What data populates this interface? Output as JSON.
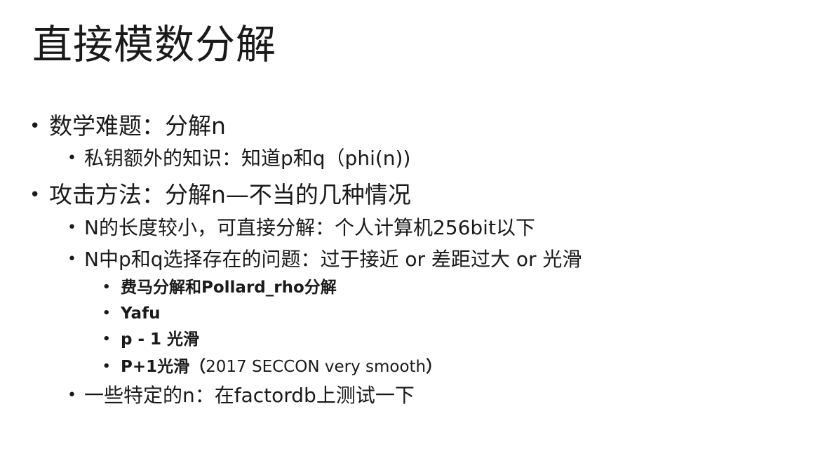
{
  "slide": {
    "title": "直接模数分解",
    "bullet_glyph": "•",
    "items": [
      {
        "text": "数学难题：分解n"
      },
      {
        "text": "私钥额外的知识：知道p和q（phi(n))"
      },
      {
        "text": "攻击方法：分解n—不当的几种情况"
      },
      {
        "text": "N的长度较小，可直接分解：个人计算机256bit以下"
      },
      {
        "text": "N中p和q选择存在的问题：过于接近 or 差距过大 or 光滑"
      },
      {
        "text": "费马分解和Pollard_rho分解"
      },
      {
        "text": "Yafu"
      },
      {
        "text": "p - 1 光滑"
      },
      {
        "text": "P+1光滑（",
        "text_suffix": "2017 SECCON very smooth",
        "text_close": "）"
      },
      {
        "text": "一些特定的n：在factordb上测试一下"
      }
    ]
  }
}
